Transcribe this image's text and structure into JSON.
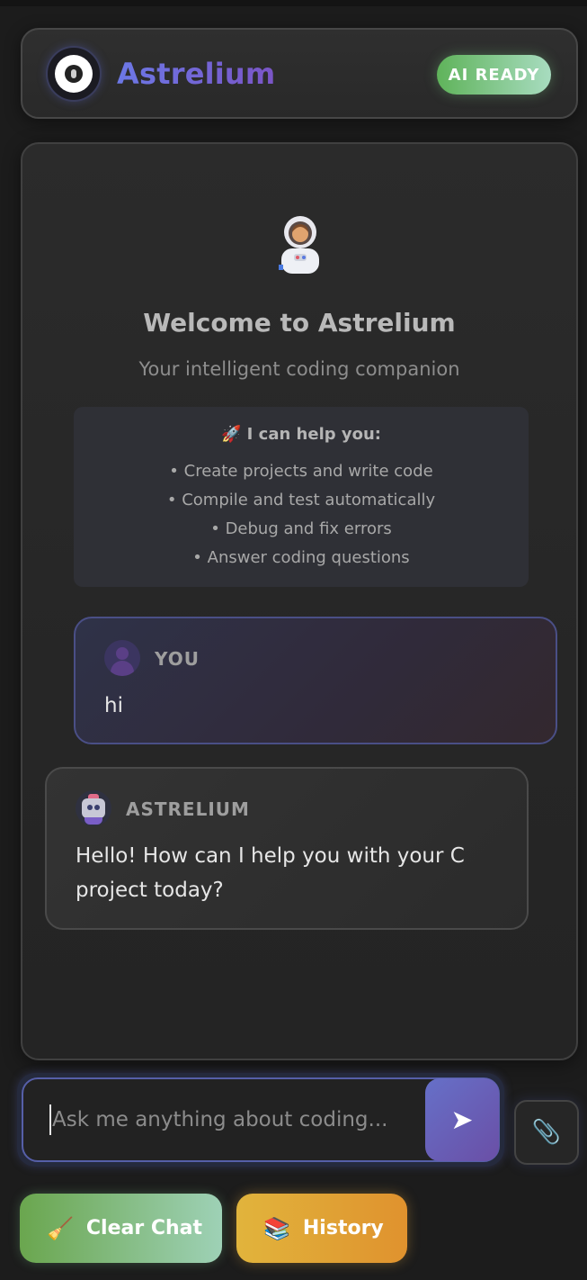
{
  "header": {
    "brand": "Astrelium",
    "status_badge": "AI READY",
    "logo_icon": "eye-logo-icon"
  },
  "welcome": {
    "icon": "astronaut-icon",
    "title": "Welcome to Astrelium",
    "subtitle": "Your intelligent coding companion",
    "help_title": "🚀 I can help you:",
    "help_items": [
      "• Create projects and write code",
      "• Compile and test automatically",
      "• Debug and fix errors",
      "• Answer coding questions"
    ]
  },
  "messages": [
    {
      "sender": "YOU",
      "text": "hi",
      "avatar": "user-avatar-icon"
    },
    {
      "sender": "ASTRELIUM",
      "text": "Hello! How can I help you with your C project today?",
      "avatar": "robot-avatar-icon"
    }
  ],
  "composer": {
    "placeholder": "Ask me anything about coding...",
    "value": "",
    "send_icon": "send-arrow-icon",
    "attach_icon": "paperclip-icon"
  },
  "actions": {
    "clear_label": "Clear Chat",
    "clear_icon": "broom-icon",
    "history_label": "History",
    "history_icon": "books-icon"
  },
  "colors": {
    "accent": "#6670c8",
    "badge_green": "#5fb35a",
    "history_orange": "#e0922e",
    "background": "#1c1c1c"
  }
}
